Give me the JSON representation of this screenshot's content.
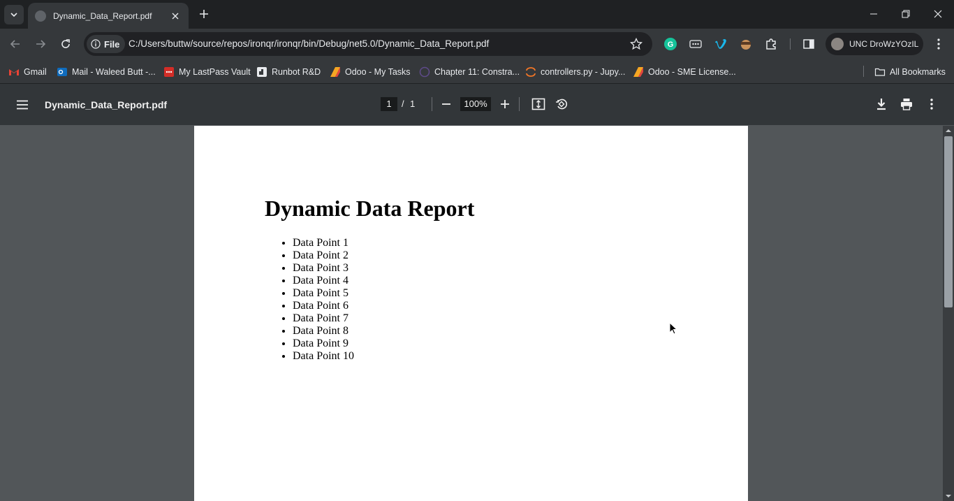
{
  "browser": {
    "tab_title": "Dynamic_Data_Report.pdf",
    "url_scheme_label": "File",
    "url": "C:/Users/buttw/source/repos/ironqr/ironqr/bin/Debug/net5.0/Dynamic_Data_Report.pdf",
    "profile_name": "UNC DroWzYOzIL"
  },
  "bookmarks": [
    {
      "label": "Gmail",
      "icon": "gmail-icon",
      "color": "#ea4335"
    },
    {
      "label": "Mail - Waleed Butt -...",
      "icon": "outlook-icon",
      "color": "#0f6cbd"
    },
    {
      "label": "My LastPass Vault",
      "icon": "lastpass-icon",
      "color": "#d32d27"
    },
    {
      "label": "Runbot R&D",
      "icon": "runbot-icon",
      "color": "#f1f3f4"
    },
    {
      "label": "Odoo - My Tasks",
      "icon": "odoo-icon",
      "color": "#f5a623"
    },
    {
      "label": "Chapter 11: Constra...",
      "icon": "chapter-icon",
      "color": "#5f6368"
    },
    {
      "label": "controllers.py - Jupy...",
      "icon": "jupyter-icon",
      "color": "#f37626"
    },
    {
      "label": "Odoo - SME License...",
      "icon": "odoo-icon",
      "color": "#f5a623"
    }
  ],
  "all_bookmarks_label": "All Bookmarks",
  "pdf": {
    "filename": "Dynamic_Data_Report.pdf",
    "current_page": "1",
    "page_separator": "/",
    "total_pages": "1",
    "zoom": "100%"
  },
  "document": {
    "title": "Dynamic Data Report",
    "items": [
      "Data Point 1",
      "Data Point 2",
      "Data Point 3",
      "Data Point 4",
      "Data Point 5",
      "Data Point 6",
      "Data Point 7",
      "Data Point 8",
      "Data Point 9",
      "Data Point 10"
    ]
  }
}
